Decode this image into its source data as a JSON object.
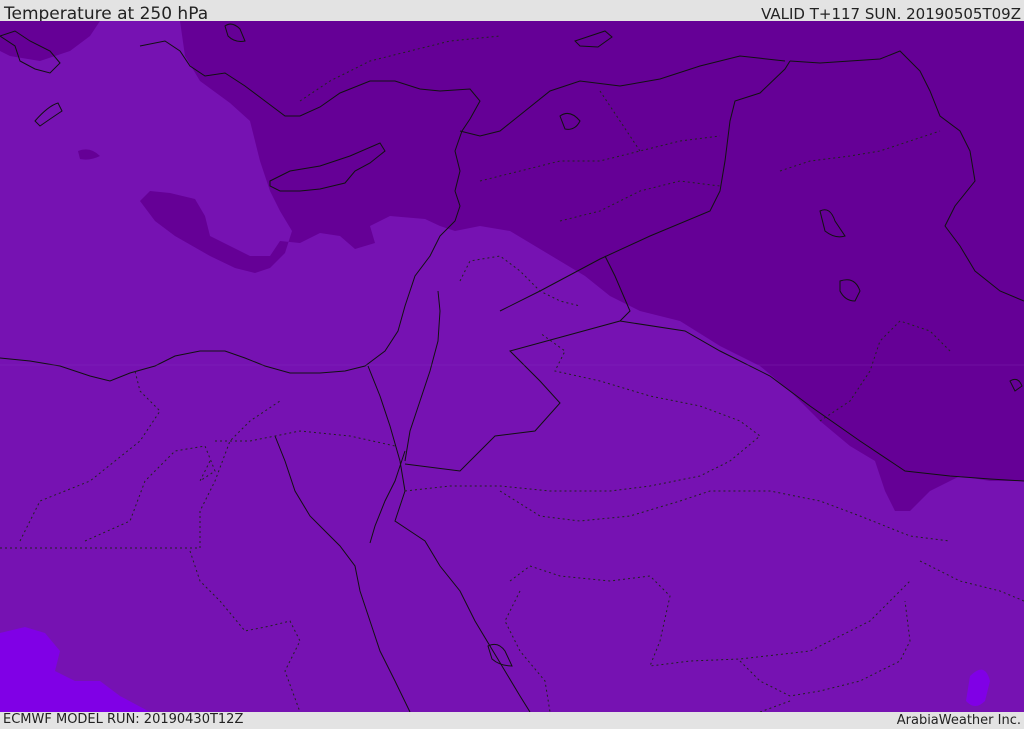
{
  "header": {
    "title": "Temperature at 250 hPa",
    "valid": "VALID T+117 SUN. 20190505T09Z"
  },
  "footer": {
    "model_run": "ECMWF MODEL RUN: 20190430T12Z",
    "credit": "ArabiaWeather Inc."
  },
  "map": {
    "colors": {
      "cold": "#650096",
      "mid": "#7612b2",
      "warm": "#8000e6",
      "coast": "#111111"
    }
  }
}
